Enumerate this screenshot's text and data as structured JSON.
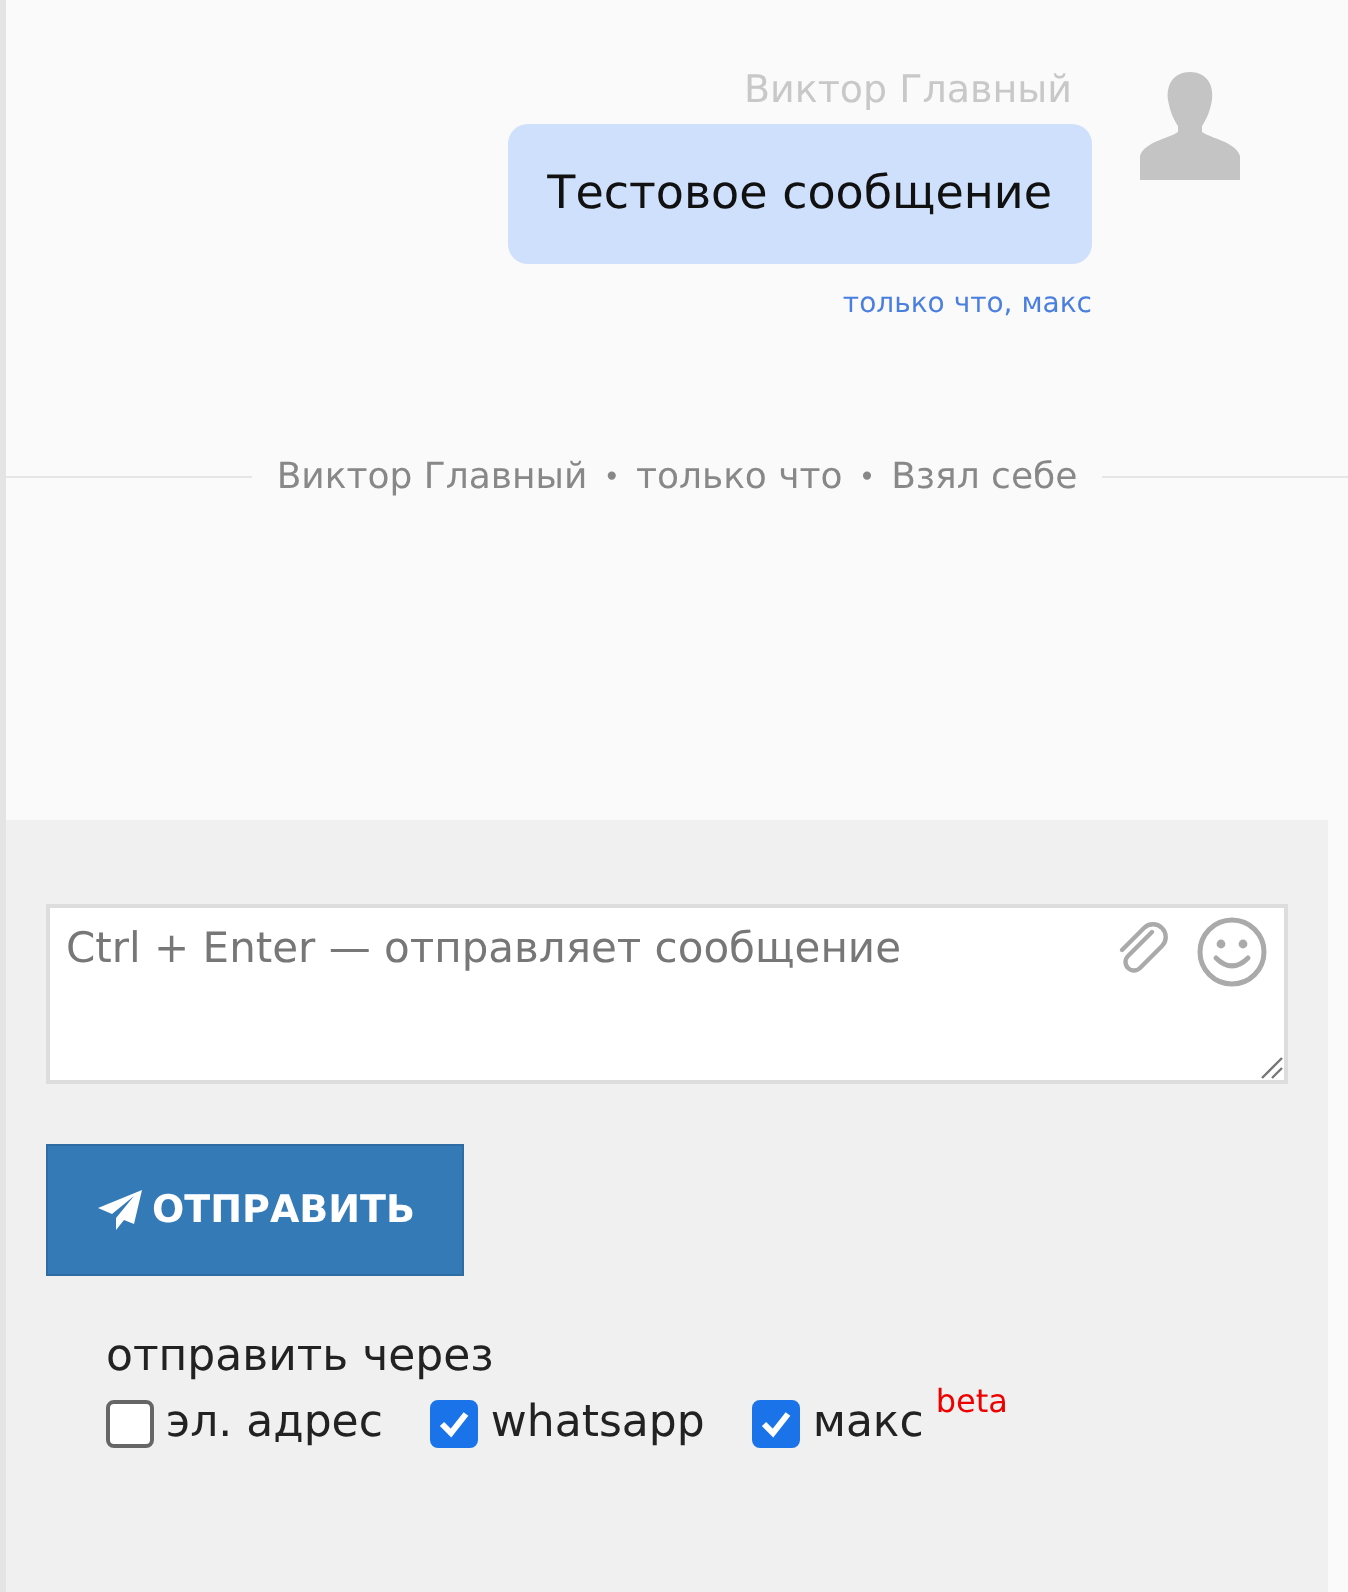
{
  "message": {
    "author": "Виктор Главный",
    "text": "Тестовое сообщение",
    "meta": "только что, макс"
  },
  "event": {
    "parts": [
      "Виктор Главный",
      "только что",
      "Взял себе"
    ],
    "separator": "•"
  },
  "composer": {
    "placeholder": "Ctrl + Enter — отправляет сообщение"
  },
  "send_button": {
    "label": "ОТПРАВИТЬ"
  },
  "send_via": {
    "label": "отправить через",
    "channels": [
      {
        "label": "эл. адрес",
        "checked": false
      },
      {
        "label": "whatsapp",
        "checked": true
      },
      {
        "label": "макс",
        "checked": true,
        "badge": "beta"
      }
    ]
  }
}
